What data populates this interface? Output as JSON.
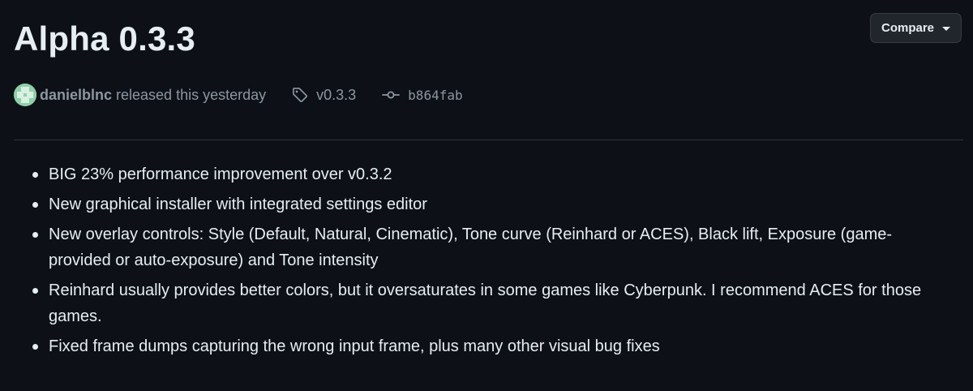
{
  "release": {
    "title": "Alpha 0.3.3",
    "compare_label": "Compare",
    "author": "danielblnc",
    "released_text": "released this yesterday",
    "tag": "v0.3.3",
    "commit": "b864fab"
  },
  "notes": [
    "BIG 23% performance improvement over v0.3.2",
    "New graphical installer with integrated settings editor",
    "New overlay controls: Style (Default, Natural, Cinematic), Tone curve (Reinhard or ACES), Black lift, Exposure (game-provided or auto-exposure) and Tone intensity",
    "Reinhard usually provides better colors, but it oversaturates in some games like Cyberpunk. I recommend ACES for those games.",
    "Fixed frame dumps capturing the wrong input frame, plus many other visual bug fixes"
  ],
  "icons": {
    "avatar": "identicon-avatar",
    "tag": "tag-icon",
    "commit": "git-commit-icon",
    "compare_caret": "triangle-down-icon"
  },
  "colors": {
    "background": "#0d1117",
    "text": "#e6edf3",
    "muted": "#8d96a0",
    "button_bg": "#21262d",
    "border": "#30363d",
    "avatar": "#8fd0a8"
  }
}
